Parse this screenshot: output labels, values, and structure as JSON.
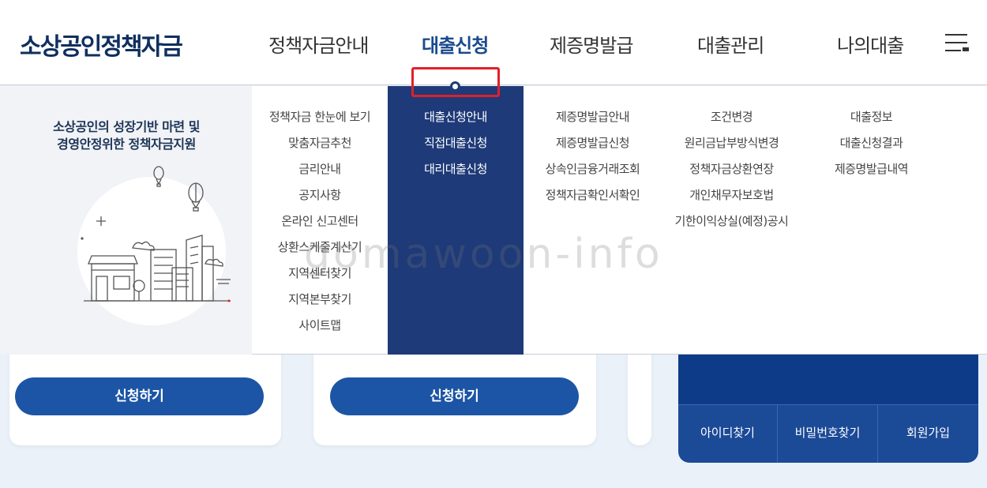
{
  "header": {
    "logo": "소상공인정책자금",
    "nav": [
      "정책자금안내",
      "대출신청",
      "제증명발급",
      "대출관리",
      "나의대출"
    ],
    "active_nav": "대출신청"
  },
  "promo": {
    "line1": "소상공인의 성장기반 마련 및",
    "line2": "경영안정위한 정책자금지원"
  },
  "menu": {
    "col1": [
      "정책자금 한눈에 보기",
      "맞춤자금추천",
      "금리안내",
      "공지사항",
      "온라인 신고센터",
      "상환스케줄계산기",
      "지역센터찾기",
      "지역본부찾기",
      "사이트맵"
    ],
    "col2": [
      "대출신청안내",
      "직접대출신청",
      "대리대출신청"
    ],
    "col3": [
      "제증명발급안내",
      "제증명발급신청",
      "상속인금융거래조회",
      "정책자금확인서확인"
    ],
    "col4": [
      "조건변경",
      "원리금납부방식변경",
      "정책자금상환연장",
      "개인채무자보호법",
      "기한이익상실(예정)공시"
    ],
    "col5": [
      "대출정보",
      "대출신청결과",
      "제증명발급내역"
    ],
    "highlighted": "대리대출신청"
  },
  "cards": {
    "apply_label_1": "신청하기",
    "apply_label_2": "신청하기"
  },
  "login": {
    "links": [
      "아이디찾기",
      "비밀번호찾기",
      "회원가입"
    ]
  },
  "watermark": "gomawoon-info",
  "colors": {
    "brand_navy": "#0f2f5e",
    "active_column": "#1e3a78",
    "button_blue": "#1c55a5",
    "highlight_red": "#e0202a"
  }
}
